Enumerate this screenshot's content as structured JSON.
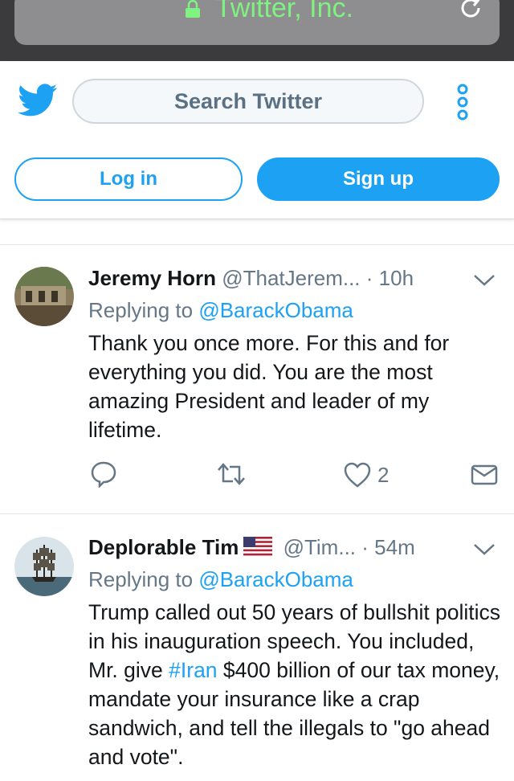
{
  "browser": {
    "url_title": "Twitter, Inc.",
    "lock_icon": "lock-icon",
    "reload_icon": "reload-icon",
    "accent": "#7ff27f"
  },
  "header": {
    "search_placeholder": "Search Twitter",
    "login_label": "Log in",
    "signup_label": "Sign up",
    "brand_color": "#1da1f2"
  },
  "tweets": [
    {
      "name": "Jeremy Horn",
      "handle": "@ThatJerem...",
      "sep": "·",
      "time": "10h",
      "reply_prefix": "Replying to",
      "reply_to": "@BarackObama",
      "text": "Thank you once more. For this and for everything you did. You are the most amazing President and leader of my lifetime.",
      "likes": "2"
    },
    {
      "name": "Deplorable Tim",
      "handle": "@Tim...",
      "sep": "·",
      "time": "54m",
      "reply_prefix": "Replying to",
      "reply_to": "@BarackObama",
      "text_pre": "Trump called out 50 years of bullshit politics in his inauguration speech. You included, Mr. give ",
      "hashtag": "#Iran",
      "text_post": " $400 billion of our tax money, mandate your insurance like a crap sandwich, and tell the illegals to \"go ahead and vote\"."
    }
  ]
}
